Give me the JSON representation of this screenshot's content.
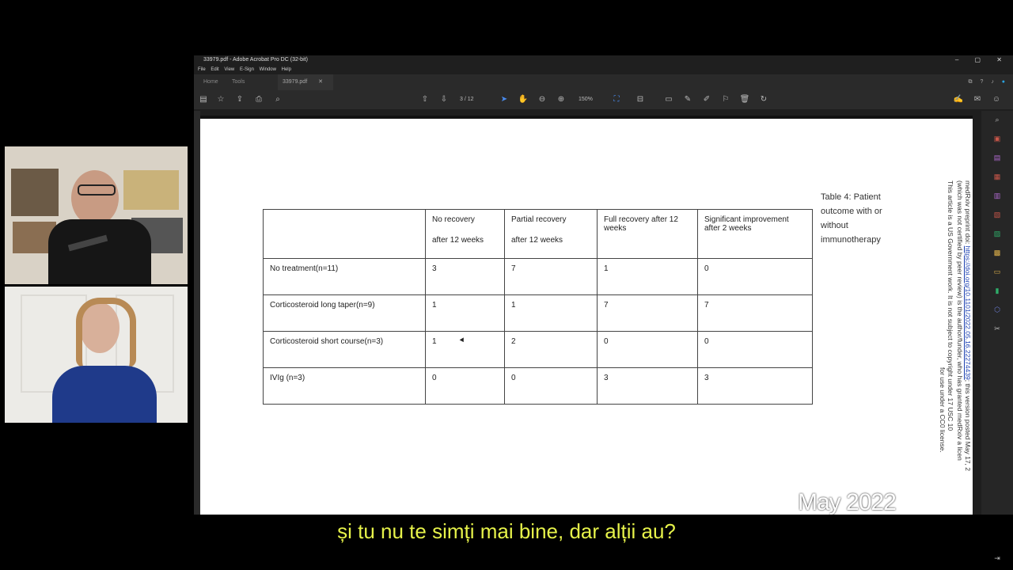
{
  "window": {
    "title": "33979.pdf - Adobe Acrobat Pro DC (32-bit)",
    "menu": [
      "File",
      "Edit",
      "View",
      "E-Sign",
      "Window",
      "Help"
    ],
    "tabs": [
      "Home",
      "Tools",
      "33979.pdf"
    ],
    "page_indicator": "3 / 12",
    "zoom": "150%"
  },
  "table": {
    "headers": [
      "",
      "No recovery\nafter 12 weeks",
      "Partial recovery\nafter 12 weeks",
      "Full recovery after 12 weeks",
      "Significant improvement after 2 weeks"
    ],
    "rows": [
      [
        "No treatment(n=11)",
        "3",
        "7",
        "1",
        "0"
      ],
      [
        "Corticosteroid long taper(n=9)",
        "1",
        "1",
        "7",
        "7"
      ],
      [
        "Corticosteroid short course(n=3)",
        "1",
        "2",
        "0",
        "0"
      ],
      [
        "IVIg (n=3)",
        "0",
        "0",
        "3",
        "3"
      ]
    ]
  },
  "caption": "Table 4: Patient outcome with or without immunotherapy",
  "side_notice": {
    "line1a": "medRxiv preprint doi: ",
    "line1_link": "https://doi.org/10.1101/2022.05.16.22274439",
    "line1b": "; this version posted May 17, 2",
    "line2": "(which was not certified by peer review) is the author/funder, who has granted medRxiv a licen",
    "line3": "This article is a US Government work. It is not subject to copyright under 17 USC 10",
    "line4": "for use under a CC0 license."
  },
  "watermark": "May 2022",
  "subtitle": "și tu nu te simți mai bine, dar alții au?",
  "colors": {
    "subtitle": "#e6f24a",
    "link": "#1a3fb0",
    "acrobat_red": "#c9574a"
  }
}
